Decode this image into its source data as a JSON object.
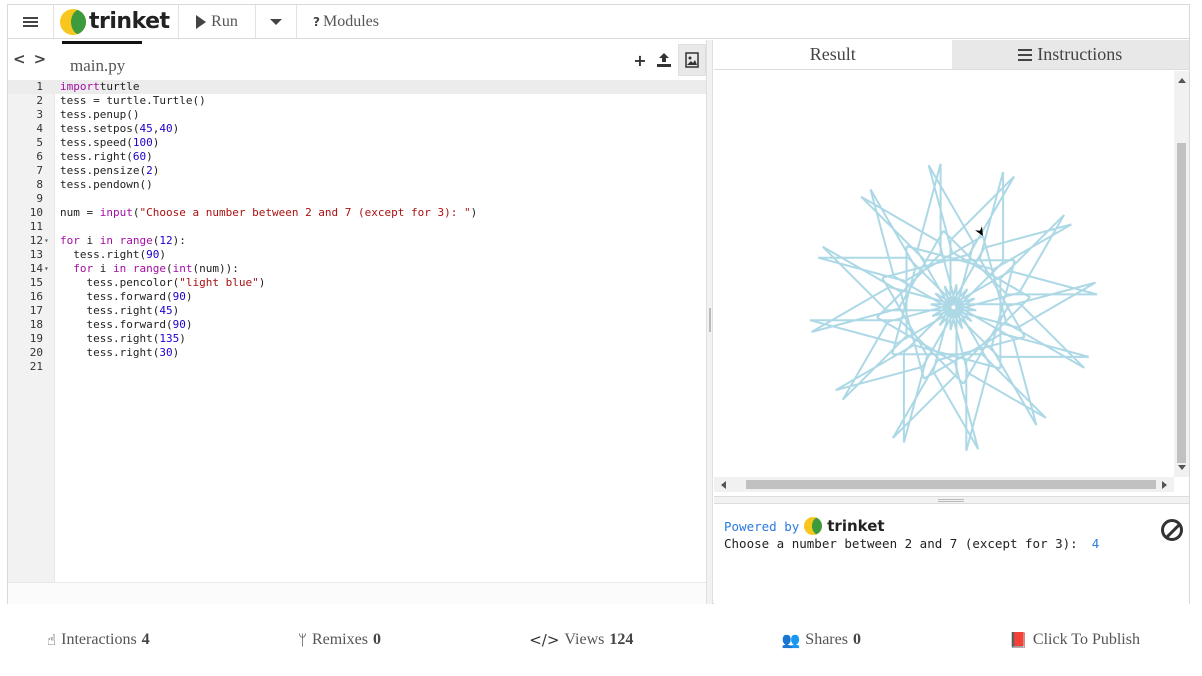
{
  "topbar": {
    "brand": "trinket",
    "run_label": "Run",
    "modules_label": "Modules"
  },
  "editor": {
    "filename": "main.py",
    "lines": [
      {
        "n": "1",
        "fold": "",
        "code": [
          [
            "kw",
            "import"
          ],
          [
            "",
            "turtle"
          ]
        ]
      },
      {
        "n": "2",
        "fold": "",
        "code": [
          [
            "",
            "tess = turtle.Turtle()"
          ]
        ]
      },
      {
        "n": "3",
        "fold": "",
        "code": [
          [
            "",
            "tess.penup()"
          ]
        ]
      },
      {
        "n": "4",
        "fold": "",
        "code": [
          [
            "",
            "tess.setpos("
          ],
          [
            "num",
            "45"
          ],
          [
            "",
            ","
          ],
          [
            "num",
            "40"
          ],
          [
            "",
            ")"
          ]
        ]
      },
      {
        "n": "5",
        "fold": "",
        "code": [
          [
            "",
            "tess.speed("
          ],
          [
            "num",
            "100"
          ],
          [
            "",
            ")"
          ]
        ]
      },
      {
        "n": "6",
        "fold": "",
        "code": [
          [
            "",
            "tess.right("
          ],
          [
            "num",
            "60"
          ],
          [
            "",
            ")"
          ]
        ]
      },
      {
        "n": "7",
        "fold": "",
        "code": [
          [
            "",
            "tess.pensize("
          ],
          [
            "num",
            "2"
          ],
          [
            "",
            ")"
          ]
        ]
      },
      {
        "n": "8",
        "fold": "",
        "code": [
          [
            "",
            "tess.pendown()"
          ]
        ]
      },
      {
        "n": "9",
        "fold": "",
        "code": []
      },
      {
        "n": "10",
        "fold": "",
        "code": [
          [
            "",
            "num = "
          ],
          [
            "kw",
            "input"
          ],
          [
            "",
            "("
          ],
          [
            "str",
            "\"Choose a number between 2 and 7 (except for 3): \""
          ],
          [
            "",
            ")"
          ]
        ]
      },
      {
        "n": "11",
        "fold": "",
        "code": []
      },
      {
        "n": "12",
        "fold": "▾",
        "code": [
          [
            "kw",
            "for"
          ],
          [
            "",
            " i "
          ],
          [
            "kw",
            "in"
          ],
          [
            "",
            " "
          ],
          [
            "kw",
            "range"
          ],
          [
            "",
            "("
          ],
          [
            "num",
            "12"
          ],
          [
            "",
            "):"
          ]
        ]
      },
      {
        "n": "13",
        "fold": "",
        "code": [
          [
            "",
            "  tess.right("
          ],
          [
            "num",
            "90"
          ],
          [
            "",
            ")"
          ]
        ]
      },
      {
        "n": "14",
        "fold": "▾",
        "code": [
          [
            "",
            "  "
          ],
          [
            "kw",
            "for"
          ],
          [
            "",
            " i "
          ],
          [
            "kw",
            "in"
          ],
          [
            "",
            " "
          ],
          [
            "kw",
            "range"
          ],
          [
            "",
            "("
          ],
          [
            "kw",
            "int"
          ],
          [
            "",
            "(num)):"
          ]
        ]
      },
      {
        "n": "15",
        "fold": "",
        "code": [
          [
            "",
            "    tess.pencolor("
          ],
          [
            "str",
            "\"light blue\""
          ],
          [
            "",
            ")"
          ]
        ]
      },
      {
        "n": "16",
        "fold": "",
        "code": [
          [
            "",
            "    tess.forward("
          ],
          [
            "num",
            "90"
          ],
          [
            "",
            ")"
          ]
        ]
      },
      {
        "n": "17",
        "fold": "",
        "code": [
          [
            "",
            "    tess.right("
          ],
          [
            "num",
            "45"
          ],
          [
            "",
            ")"
          ]
        ]
      },
      {
        "n": "18",
        "fold": "",
        "code": [
          [
            "",
            "    tess.forward("
          ],
          [
            "num",
            "90"
          ],
          [
            "",
            ")"
          ]
        ]
      },
      {
        "n": "19",
        "fold": "",
        "code": [
          [
            "",
            "    tess.right("
          ],
          [
            "num",
            "135"
          ],
          [
            "",
            ")"
          ]
        ]
      },
      {
        "n": "20",
        "fold": "",
        "code": [
          [
            "",
            "    tess.right("
          ],
          [
            "num",
            "30"
          ],
          [
            "",
            ")"
          ]
        ]
      },
      {
        "n": "21",
        "fold": "",
        "code": []
      }
    ]
  },
  "output": {
    "tab_result": "Result",
    "tab_instructions": "Instructions",
    "powered_by": "Powered by",
    "brand": "trinket",
    "prompt": "Choose a number between 2 and 7 (except for 3):",
    "answer": "4",
    "pen_color": "#add8e6"
  },
  "footer": {
    "interactions_label": "Interactions",
    "interactions_count": "4",
    "remixes_label": "Remixes",
    "remixes_count": "0",
    "views_label": "Views",
    "views_count": "124",
    "shares_label": "Shares",
    "shares_count": "0",
    "publish_label": "Click To Publish"
  }
}
